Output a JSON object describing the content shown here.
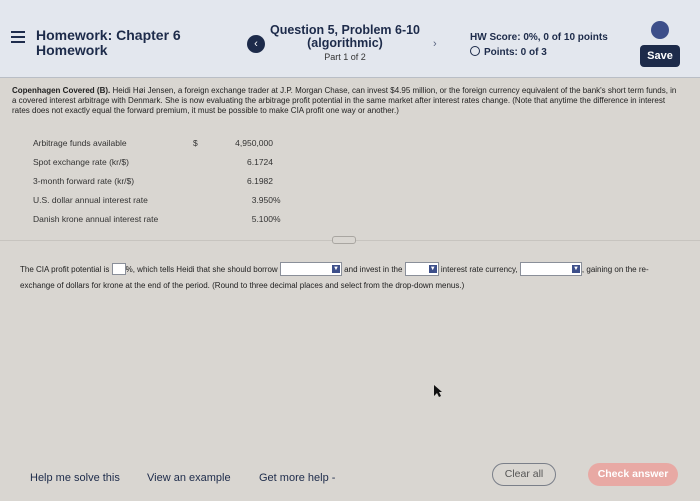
{
  "header": {
    "homework_title": "Homework: Chapter 6",
    "homework_subtitle": "Homework",
    "question_title": "Question 5, Problem 6-10",
    "question_algorithmic": "(algorithmic)",
    "part": "Part 1 of 2",
    "hw_score": "HW Score: 0%, 0 of 10 points",
    "points": "Points: 0 of 3",
    "save_label": "Save",
    "prev_icon": "chevron-left-icon",
    "next_icon": "chevron-right-icon",
    "settings_icon": "gear-icon",
    "accent_color": "#1d2b4a"
  },
  "problem": {
    "heading": "Copenhagen Covered (B).",
    "text": "Heidi Høi Jensen, a foreign exchange trader at J.P. Morgan Chase, can invest $4.95 million, or the foreign currency equivalent of the bank's short term funds, in a covered interest arbitrage with Denmark. She is now evaluating the arbitrage profit potential in the same market after interest rates change. (Note that anytime the difference in interest rates does not exactly equal the forward premium, it must be possible to make CIA profit one way or another.)"
  },
  "data_table": [
    {
      "label": "Arbitrage funds available",
      "currency": "$",
      "value": "4,950,000",
      "unit": ""
    },
    {
      "label": "Spot exchange rate (kr/$)",
      "currency": "",
      "value": "6.1724",
      "unit": ""
    },
    {
      "label": "3-month forward rate (kr/$)",
      "currency": "",
      "value": "6.1982",
      "unit": ""
    },
    {
      "label": "U.S. dollar annual interest rate",
      "currency": "",
      "value": "3.950",
      "unit": "%"
    },
    {
      "label": "Danish krone annual interest rate",
      "currency": "",
      "value": "5.100",
      "unit": "%"
    }
  ],
  "answer": {
    "part1": "The CIA profit potential is",
    "part2": "%, which tells Heidi that she should borrow",
    "part3": "and invest in the",
    "part4": "interest rate currency,",
    "part5": ", gaining on the re-exchange of dollars for krone at the end of the period.",
    "instruction": "(Round to three decimal places and select from the drop-down menus.)"
  },
  "footer": {
    "help_me": "Help me solve this",
    "example": "View an example",
    "more_help": "Get more help -",
    "clear_all": "Clear all",
    "check_answer": "Check answer",
    "check_color": "#e8a9a4"
  }
}
